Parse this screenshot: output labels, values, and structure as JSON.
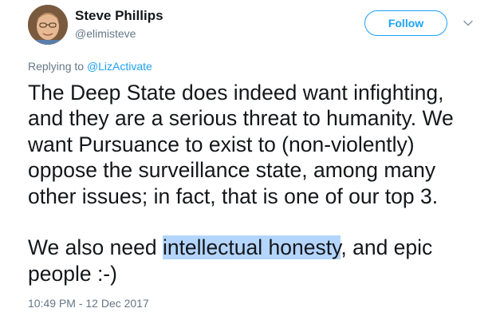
{
  "tweet": {
    "author": {
      "display_name": "Steve Phillips",
      "handle": "@elimisteve"
    },
    "follow_label": "Follow",
    "reply_prefix": "Replying to ",
    "reply_mention": "@LizActivate",
    "body": {
      "p1_line1": "The Deep State does indeed want infighting,",
      "p1_line2": "and they are a serious threat to humanity. We",
      "p1_line3": "want Pursuance to exist to (non-violently)",
      "p1_line4": "oppose the surveillance state, among many",
      "p1_line5": "other issues; in fact, that is one of our top 3.",
      "p2_before": "We also need ",
      "p2_highlight": "intellectual honesty",
      "p2_after": ", and epic",
      "p2_line2": "people :-)"
    },
    "timestamp": "10:49 PM - 12 Dec 2017"
  },
  "colors": {
    "accent": "#1da1f2",
    "text": "#14171a",
    "muted": "#657786",
    "selection": "#b4d5fe"
  },
  "icons": {
    "avatar": "user-photo",
    "caret": "chevron-down-icon"
  }
}
